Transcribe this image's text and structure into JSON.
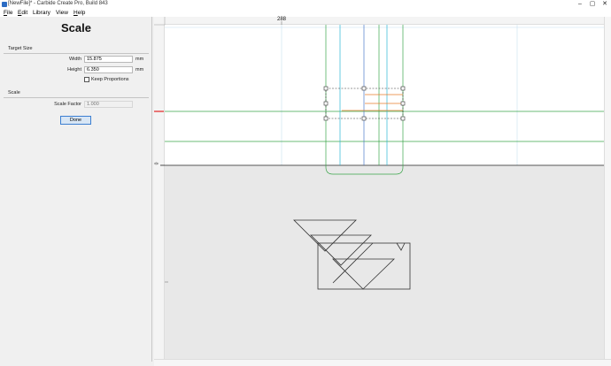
{
  "window": {
    "title": "[NewFile]* - Carbide Create Pro, Build 843",
    "controls": {
      "minimize": "–",
      "maximize": "▢",
      "close": "✕"
    }
  },
  "menu": {
    "items": [
      {
        "underline": "F",
        "rest": "ile"
      },
      {
        "underline": "E",
        "rest": "dit"
      },
      {
        "underline": "",
        "rest": "Library"
      },
      {
        "underline": "",
        "rest": "View"
      },
      {
        "underline": "H",
        "rest": "elp"
      }
    ]
  },
  "panel": {
    "title": "Scale",
    "target_size": {
      "heading": "Target Size",
      "width_label": "Width",
      "width_value": "15.875",
      "width_unit": "mm",
      "height_label": "Height",
      "height_value": "6.350",
      "height_unit": "mm",
      "keep_proportions_label": "Keep Proportions",
      "keep_proportions_checked": false
    },
    "scale": {
      "heading": "Scale",
      "factor_label": "Scale Factor",
      "factor_placeholder": "1.000"
    },
    "done_label": "Done"
  },
  "canvas": {
    "ruler_top_label": "288",
    "ruler_left_label": "0",
    "colors": {
      "background": "#ffffff",
      "off_stock": "#e8e8e8",
      "grid": "#c7dff0",
      "green_guide": "#3aa54a",
      "blue_guide": "#2ab6d4",
      "orange_guide": "#e87b2a",
      "red_marker": "#e02020",
      "outline": "#333333"
    }
  }
}
